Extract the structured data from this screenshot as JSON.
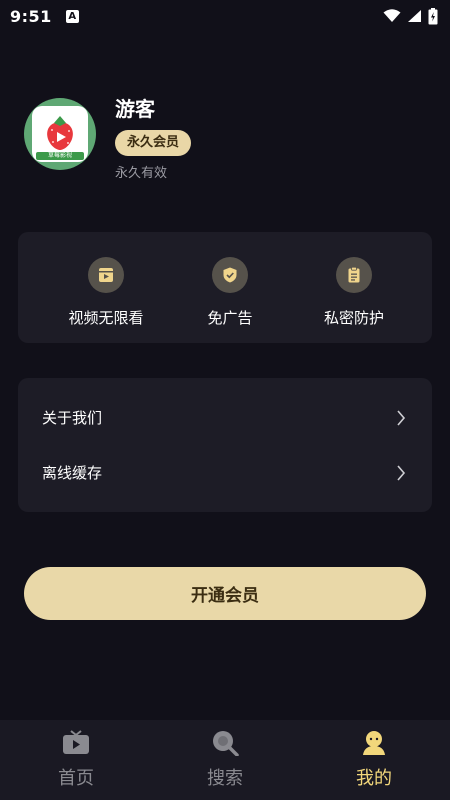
{
  "status_bar": {
    "time": "9:51",
    "notification": "A"
  },
  "profile": {
    "username": "游客",
    "badge": "永久会员",
    "validity": "永久有效",
    "avatar_icon": "strawberry-logo",
    "avatar_caption": "草莓影视"
  },
  "perks": [
    {
      "icon": "video-icon",
      "label": "视频无限看"
    },
    {
      "icon": "shield-icon",
      "label": "免广告"
    },
    {
      "icon": "clipboard-icon",
      "label": "私密防护"
    }
  ],
  "menu": [
    {
      "label": "关于我们"
    },
    {
      "label": "离线缓存"
    }
  ],
  "open_button": "开通会员",
  "nav": [
    {
      "icon": "tv-icon",
      "label": "首页",
      "active": false
    },
    {
      "icon": "search-icon",
      "label": "搜索",
      "active": false
    },
    {
      "icon": "profile-icon",
      "label": "我的",
      "active": true
    }
  ],
  "colors": {
    "background": "#111019",
    "card": "#1d1c26",
    "gold": "#e9d8a8",
    "active_nav": "#f2d77b"
  }
}
